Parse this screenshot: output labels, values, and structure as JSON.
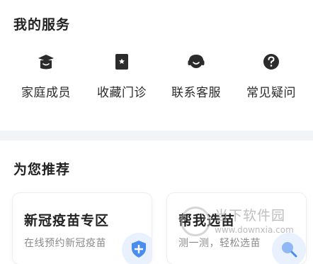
{
  "my_services": {
    "title": "我的服务",
    "items": [
      {
        "label": "家庭成员",
        "icon": "family-members-icon"
      },
      {
        "label": "收藏门诊",
        "icon": "favorite-clinic-icon"
      },
      {
        "label": "联系客服",
        "icon": "customer-service-icon"
      },
      {
        "label": "常见疑问",
        "icon": "faq-icon"
      }
    ]
  },
  "recommend": {
    "title": "为您推荐",
    "cards": [
      {
        "title": "新冠疫苗专区",
        "subtitle": "在线预约新冠疫苗",
        "icon": "shield-icon"
      },
      {
        "title": "帮我选苗",
        "subtitle": "测一测，轻松选苗",
        "icon": "search-icon"
      }
    ]
  },
  "watermark": {
    "name": "当下软件园",
    "url": "www.downxia.com"
  },
  "colors": {
    "icon_dark": "#2b2b2b",
    "badge_bg": "#e8f1fd",
    "accent_blue": "#4a8df0",
    "band": "#f3f4f6"
  }
}
